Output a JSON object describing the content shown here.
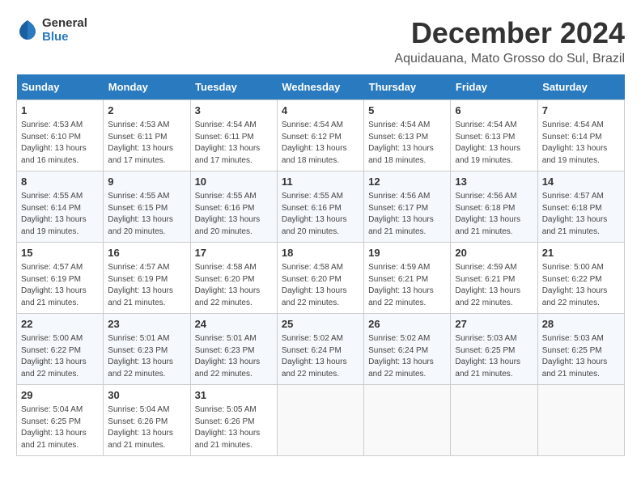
{
  "header": {
    "logo_general": "General",
    "logo_blue": "Blue",
    "month_title": "December 2024",
    "location": "Aquidauana, Mato Grosso do Sul, Brazil"
  },
  "weekdays": [
    "Sunday",
    "Monday",
    "Tuesday",
    "Wednesday",
    "Thursday",
    "Friday",
    "Saturday"
  ],
  "weeks": [
    [
      {
        "day": "1",
        "sunrise": "4:53 AM",
        "sunset": "6:10 PM",
        "daylight": "13 hours and 16 minutes."
      },
      {
        "day": "2",
        "sunrise": "4:53 AM",
        "sunset": "6:11 PM",
        "daylight": "13 hours and 17 minutes."
      },
      {
        "day": "3",
        "sunrise": "4:54 AM",
        "sunset": "6:11 PM",
        "daylight": "13 hours and 17 minutes."
      },
      {
        "day": "4",
        "sunrise": "4:54 AM",
        "sunset": "6:12 PM",
        "daylight": "13 hours and 18 minutes."
      },
      {
        "day": "5",
        "sunrise": "4:54 AM",
        "sunset": "6:13 PM",
        "daylight": "13 hours and 18 minutes."
      },
      {
        "day": "6",
        "sunrise": "4:54 AM",
        "sunset": "6:13 PM",
        "daylight": "13 hours and 19 minutes."
      },
      {
        "day": "7",
        "sunrise": "4:54 AM",
        "sunset": "6:14 PM",
        "daylight": "13 hours and 19 minutes."
      }
    ],
    [
      {
        "day": "8",
        "sunrise": "4:55 AM",
        "sunset": "6:14 PM",
        "daylight": "13 hours and 19 minutes."
      },
      {
        "day": "9",
        "sunrise": "4:55 AM",
        "sunset": "6:15 PM",
        "daylight": "13 hours and 20 minutes."
      },
      {
        "day": "10",
        "sunrise": "4:55 AM",
        "sunset": "6:16 PM",
        "daylight": "13 hours and 20 minutes."
      },
      {
        "day": "11",
        "sunrise": "4:55 AM",
        "sunset": "6:16 PM",
        "daylight": "13 hours and 20 minutes."
      },
      {
        "day": "12",
        "sunrise": "4:56 AM",
        "sunset": "6:17 PM",
        "daylight": "13 hours and 21 minutes."
      },
      {
        "day": "13",
        "sunrise": "4:56 AM",
        "sunset": "6:18 PM",
        "daylight": "13 hours and 21 minutes."
      },
      {
        "day": "14",
        "sunrise": "4:57 AM",
        "sunset": "6:18 PM",
        "daylight": "13 hours and 21 minutes."
      }
    ],
    [
      {
        "day": "15",
        "sunrise": "4:57 AM",
        "sunset": "6:19 PM",
        "daylight": "13 hours and 21 minutes."
      },
      {
        "day": "16",
        "sunrise": "4:57 AM",
        "sunset": "6:19 PM",
        "daylight": "13 hours and 21 minutes."
      },
      {
        "day": "17",
        "sunrise": "4:58 AM",
        "sunset": "6:20 PM",
        "daylight": "13 hours and 22 minutes."
      },
      {
        "day": "18",
        "sunrise": "4:58 AM",
        "sunset": "6:20 PM",
        "daylight": "13 hours and 22 minutes."
      },
      {
        "day": "19",
        "sunrise": "4:59 AM",
        "sunset": "6:21 PM",
        "daylight": "13 hours and 22 minutes."
      },
      {
        "day": "20",
        "sunrise": "4:59 AM",
        "sunset": "6:21 PM",
        "daylight": "13 hours and 22 minutes."
      },
      {
        "day": "21",
        "sunrise": "5:00 AM",
        "sunset": "6:22 PM",
        "daylight": "13 hours and 22 minutes."
      }
    ],
    [
      {
        "day": "22",
        "sunrise": "5:00 AM",
        "sunset": "6:22 PM",
        "daylight": "13 hours and 22 minutes."
      },
      {
        "day": "23",
        "sunrise": "5:01 AM",
        "sunset": "6:23 PM",
        "daylight": "13 hours and 22 minutes."
      },
      {
        "day": "24",
        "sunrise": "5:01 AM",
        "sunset": "6:23 PM",
        "daylight": "13 hours and 22 minutes."
      },
      {
        "day": "25",
        "sunrise": "5:02 AM",
        "sunset": "6:24 PM",
        "daylight": "13 hours and 22 minutes."
      },
      {
        "day": "26",
        "sunrise": "5:02 AM",
        "sunset": "6:24 PM",
        "daylight": "13 hours and 22 minutes."
      },
      {
        "day": "27",
        "sunrise": "5:03 AM",
        "sunset": "6:25 PM",
        "daylight": "13 hours and 21 minutes."
      },
      {
        "day": "28",
        "sunrise": "5:03 AM",
        "sunset": "6:25 PM",
        "daylight": "13 hours and 21 minutes."
      }
    ],
    [
      {
        "day": "29",
        "sunrise": "5:04 AM",
        "sunset": "6:25 PM",
        "daylight": "13 hours and 21 minutes."
      },
      {
        "day": "30",
        "sunrise": "5:04 AM",
        "sunset": "6:26 PM",
        "daylight": "13 hours and 21 minutes."
      },
      {
        "day": "31",
        "sunrise": "5:05 AM",
        "sunset": "6:26 PM",
        "daylight": "13 hours and 21 minutes."
      },
      null,
      null,
      null,
      null
    ]
  ],
  "labels": {
    "sunrise": "Sunrise:",
    "sunset": "Sunset:",
    "daylight": "Daylight:"
  }
}
